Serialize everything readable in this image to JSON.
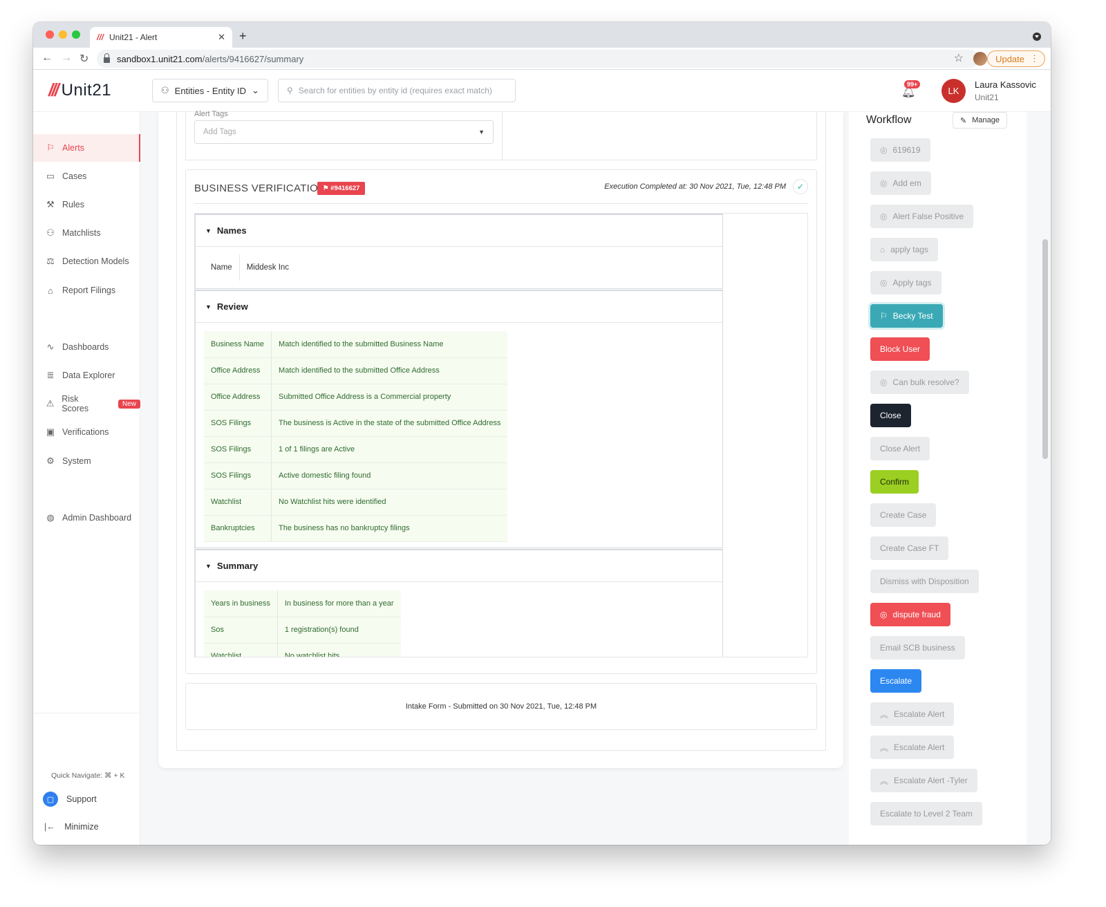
{
  "browser": {
    "tab_title": "Unit21 - Alert",
    "tab_close": "✕",
    "new_tab": "+",
    "url_host": "sandbox1.unit21.com",
    "url_path": "/alerts/9416627/summary",
    "update_label": "Update"
  },
  "header": {
    "logo_slashes": "///",
    "logo_text": "Unit21",
    "entity_select": "Entities - Entity ID",
    "search_placeholder": "Search for entities by entity id (requires exact match)",
    "notification_badge": "99+",
    "user_initials": "LK",
    "user_name": "Laura Kassovic",
    "user_org": "Unit21"
  },
  "sidebar": {
    "items": [
      {
        "label": "Alerts",
        "icon": "flag-icon"
      },
      {
        "label": "Cases",
        "icon": "briefcase-icon"
      },
      {
        "label": "Rules",
        "icon": "rules-icon"
      },
      {
        "label": "Matchlists",
        "icon": "user-list-icon"
      },
      {
        "label": "Detection Models",
        "icon": "scale-icon"
      },
      {
        "label": "Report Filings",
        "icon": "bank-icon"
      },
      {
        "label": "Dashboards",
        "icon": "chart-icon"
      },
      {
        "label": "Data Explorer",
        "icon": "data-search-icon"
      },
      {
        "label": "Risk Scores",
        "icon": "warning-icon",
        "badge": "New"
      },
      {
        "label": "Verifications",
        "icon": "id-card-icon"
      },
      {
        "label": "System",
        "icon": "gear-icon"
      },
      {
        "label": "Admin Dashboard",
        "icon": "globe-icon"
      }
    ],
    "quick_navigate": "Quick Navigate: ⌘ + K",
    "support": "Support",
    "minimize": "Minimize"
  },
  "alert_tags": {
    "label": "Alert Tags",
    "placeholder": "Add Tags"
  },
  "business_verification": {
    "title": "BUSINESS VERIFICATION",
    "badge": "#9416627",
    "execution": "Execution Completed at: 30 Nov 2021, Tue, 12:48 PM",
    "sections": {
      "names": {
        "title": "Names",
        "key": "Name",
        "value": "Middesk Inc"
      },
      "review": {
        "title": "Review",
        "rows": [
          {
            "key": "Business Name",
            "value": "Match identified to the submitted Business Name"
          },
          {
            "key": "Office Address",
            "value": "Match identified to the submitted Office Address"
          },
          {
            "key": "Office Address",
            "value": "Submitted Office Address is a Commercial property"
          },
          {
            "key": "SOS Filings",
            "value": "The business is Active in the state of the submitted Office Address"
          },
          {
            "key": "SOS Filings",
            "value": "1 of 1 filings are Active"
          },
          {
            "key": "SOS Filings",
            "value": "Active domestic filing found"
          },
          {
            "key": "Watchlist",
            "value": "No Watchlist hits were identified"
          },
          {
            "key": "Bankruptcies",
            "value": "The business has no bankruptcy filings"
          }
        ]
      },
      "summary": {
        "title": "Summary",
        "rows": [
          {
            "key": "Years in business",
            "value": "In business for more than a year"
          },
          {
            "key": "Sos",
            "value": "1 registration(s) found"
          },
          {
            "key": "Watchlist",
            "value": "No watchlist hits"
          }
        ]
      }
    }
  },
  "intake_form": "Intake Form - Submitted on 30 Nov 2021, Tue, 12:48 PM",
  "workflow": {
    "title": "Workflow",
    "manage_label": "Manage",
    "buttons": [
      {
        "label": "619619",
        "style": "disabled",
        "icon": "check-circle-icon"
      },
      {
        "label": "Add em",
        "style": "disabled",
        "icon": "check-circle-icon"
      },
      {
        "label": "Alert False Positive",
        "style": "disabled",
        "icon": "check-circle-icon"
      },
      {
        "label": "apply tags",
        "style": "disabled",
        "icon": "tag-icon"
      },
      {
        "label": "Apply tags",
        "style": "disabled",
        "icon": "check-circle-icon"
      },
      {
        "label": "Becky Test",
        "style": "teal",
        "icon": "flag-icon"
      },
      {
        "label": "Block User",
        "style": "red",
        "icon": ""
      },
      {
        "label": "Can bulk resolve?",
        "style": "disabled",
        "icon": "check-circle-icon"
      },
      {
        "label": "Close",
        "style": "dark",
        "icon": ""
      },
      {
        "label": "Close Alert",
        "style": "disabled",
        "icon": ""
      },
      {
        "label": "Confirm",
        "style": "green",
        "icon": ""
      },
      {
        "label": "Create Case",
        "style": "disabled",
        "icon": ""
      },
      {
        "label": "Create Case FT",
        "style": "disabled",
        "icon": ""
      },
      {
        "label": "Dismiss with Disposition",
        "style": "disabled",
        "icon": ""
      },
      {
        "label": "dispute fraud",
        "style": "red",
        "icon": "check-circle-icon"
      },
      {
        "label": "Email SCB business",
        "style": "disabled",
        "icon": ""
      },
      {
        "label": "Escalate",
        "style": "blue",
        "icon": ""
      },
      {
        "label": "Escalate Alert",
        "style": "disabled",
        "icon": "chevron-up-icon"
      },
      {
        "label": "Escalate Alert",
        "style": "disabled",
        "icon": "chevron-up-icon"
      },
      {
        "label": "Escalate Alert -Tyler",
        "style": "disabled",
        "icon": "chevron-up-icon"
      },
      {
        "label": "Escalate to Level 2 Team",
        "style": "disabled",
        "icon": ""
      }
    ]
  },
  "colors": {
    "brand_red": "#e8454f",
    "teal": "#3aa9b5",
    "green": "#9bcf22",
    "blue": "#2c88f0",
    "dark": "#1c2430"
  }
}
